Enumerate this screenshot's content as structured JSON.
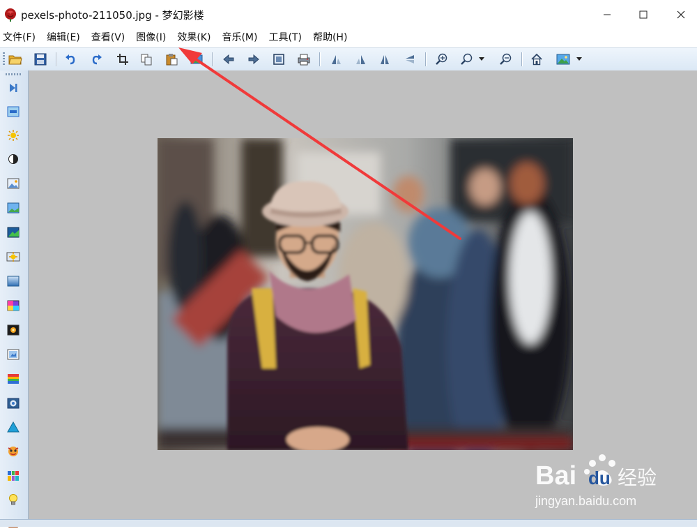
{
  "window": {
    "title": "pexels-photo-211050.jpg - 梦幻影楼",
    "icon": "app-rose-icon"
  },
  "menu": [
    {
      "label": "文件(F)"
    },
    {
      "label": "编辑(E)"
    },
    {
      "label": "查看(V)"
    },
    {
      "label": "图像(I)"
    },
    {
      "label": "效果(K)"
    },
    {
      "label": "音乐(M)"
    },
    {
      "label": "工具(T)"
    },
    {
      "label": "帮助(H)"
    }
  ],
  "toolbar": {
    "buttons": [
      "open-folder-icon",
      "save-icon",
      "undo-icon",
      "redo-icon",
      "crop-icon",
      "copy-icon",
      "paste-icon",
      "image-insert-icon",
      "prev-arrow-icon",
      "next-arrow-icon",
      "fit-window-icon",
      "print-icon",
      "rotate-left-icon",
      "rotate-right-icon",
      "flip-horizontal-icon",
      "flip-vertical-icon",
      "zoom-in-icon",
      "zoom-icon",
      "zoom-dropdown-icon",
      "zoom-out-icon",
      "home-icon",
      "image-view-icon",
      "view-dropdown-icon"
    ]
  },
  "sidebar": {
    "tools": [
      "next-frame-icon",
      "frame-icon",
      "brightness-icon",
      "contrast-icon",
      "image-adjust-icon",
      "landscape-icon",
      "color-balance-icon",
      "sparkle-icon",
      "gradient-icon",
      "color-wheel-icon",
      "texture-icon",
      "image-frame-icon",
      "rainbow-icon",
      "lens-icon",
      "triangle-icon",
      "mask-icon",
      "grid-icon",
      "lightbulb-icon"
    ]
  },
  "canvas": {
    "background": "#c0c0c0",
    "photo_subject": "portrait-photo"
  },
  "annotation": {
    "color": "#f03a3a",
    "target": "image-menu"
  },
  "watermark": {
    "brand_left": "Bai",
    "brand_right": "du",
    "brand_cn": "经验",
    "url": "jingyan.baidu.com"
  }
}
